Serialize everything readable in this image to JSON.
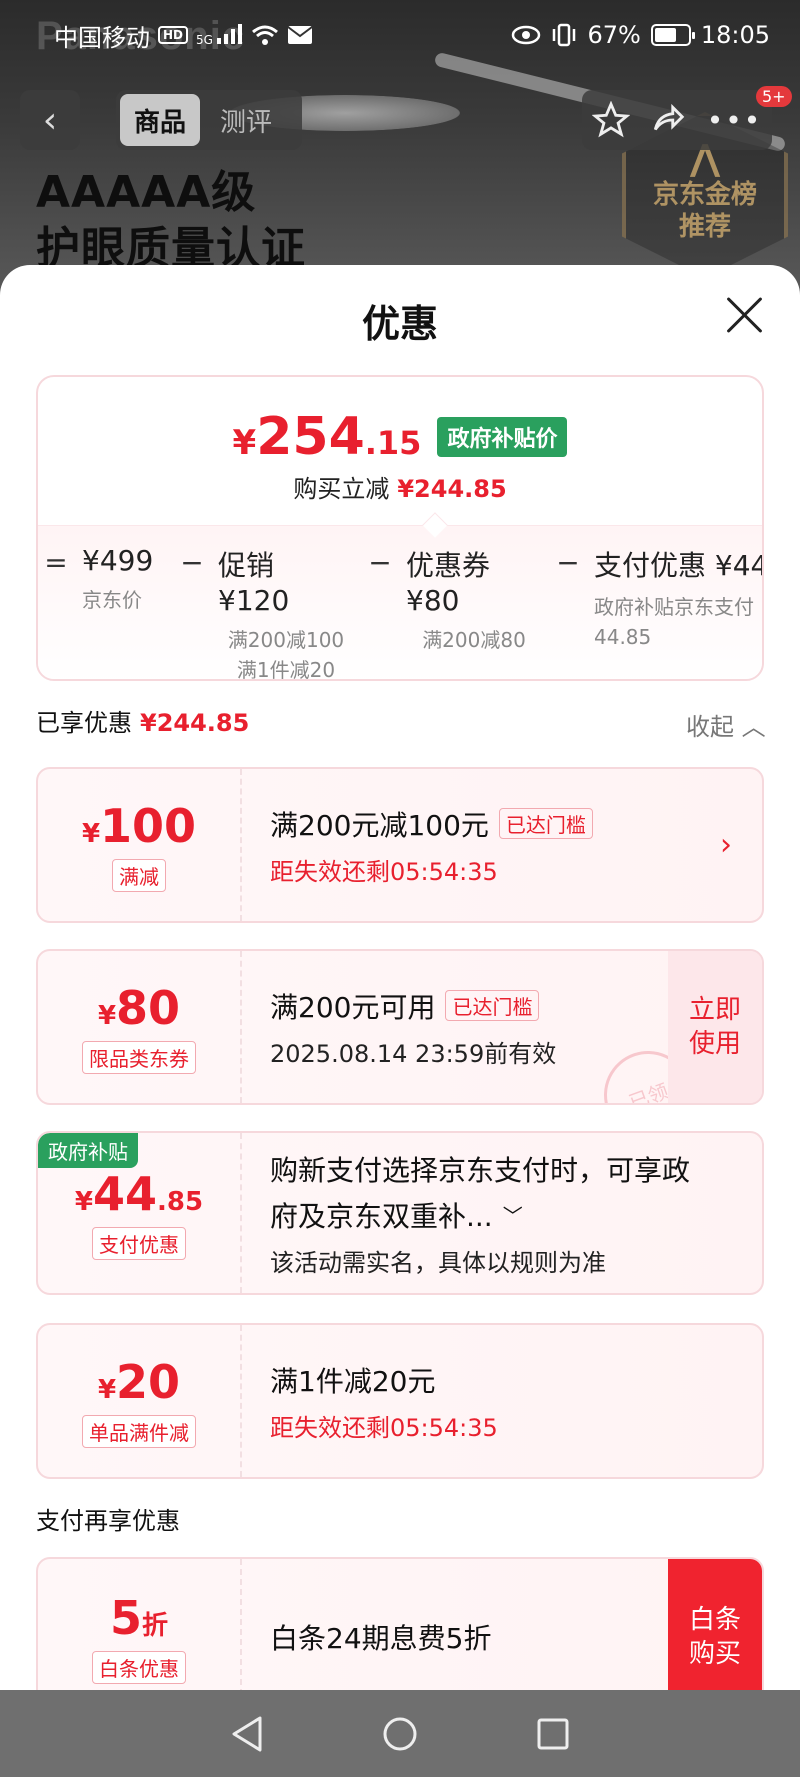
{
  "status_bar": {
    "carrier": "中国移动",
    "net_hd": "HD",
    "net_type": "5G",
    "battery_percent": "67%",
    "battery_level": 0.67,
    "time": "18:05"
  },
  "product_background": {
    "brand_watermark": "Panasonic",
    "hero_line1": "AAAAA级",
    "hero_line2": "护眼质量认证",
    "badge_line1": "京东金榜",
    "badge_line2": "推荐"
  },
  "nav": {
    "back_icon": "chevron-left-icon",
    "tabs": [
      {
        "label": "商品",
        "active": true
      },
      {
        "label": "测评",
        "active": false
      }
    ],
    "badge": "5+"
  },
  "sheet": {
    "title": "优惠",
    "summary": {
      "final_price_yen": "¥",
      "final_price_int": "254",
      "final_price_dec": ".15",
      "gov_tag": "政府补贴价",
      "save_label": "购买立减",
      "save_amount": "¥244.85",
      "calc": [
        {
          "op": "=",
          "value": "¥499",
          "sub": [
            "京东价"
          ]
        },
        {
          "op": "−",
          "value": "促销 ¥120",
          "sub": [
            "满200减100",
            "满1件减20"
          ]
        },
        {
          "op": "−",
          "value": "优惠券 ¥80",
          "sub": [
            "满200减80"
          ]
        },
        {
          "op": "−",
          "value": "支付优惠 ¥44",
          "sub": [
            "政府补贴京东支付",
            "44.85"
          ]
        }
      ]
    },
    "enjoyed_label": "已享优惠",
    "enjoyed_amount": "¥244.85",
    "collapse_label": "收起",
    "coupons": [
      {
        "yen": "¥",
        "amount": "100",
        "dec": "",
        "tag": "满减",
        "title": "满200元减100元",
        "reach": "已达门槛",
        "sub": "距失效还剩05:54:35"
      },
      {
        "yen": "¥",
        "amount": "80",
        "dec": "",
        "tag": "限品类东券",
        "title": "满200元可用",
        "reach": "已达门槛",
        "sub": "2025.08.14 23:59前有效",
        "action": "立即使用",
        "action_l1": "立即",
        "action_l2": "使用",
        "stamp": "已领"
      },
      {
        "yen": "¥",
        "amount": "44",
        "dec": ".85",
        "tag": "支付优惠",
        "corner": "政府补贴",
        "title_l1": "购新支付选择京东支付时，可享政",
        "title_l2": "府及京东双重补...",
        "sub": "该活动需实名，具体以规则为准"
      },
      {
        "yen": "¥",
        "amount": "20",
        "dec": "",
        "tag": "单品满件减",
        "title": "满1件减20元",
        "sub": "距失效还剩05:54:35"
      }
    ],
    "pay_more_label": "支付再享优惠",
    "pay_coupon": {
      "amount": "5",
      "unit": "折",
      "tag": "白条优惠",
      "title": "白条24期息费5折",
      "action_l1": "白条",
      "action_l2": "购买"
    }
  },
  "system_nav": [
    "back-triangle-icon",
    "home-circle-icon",
    "recents-square-icon"
  ]
}
